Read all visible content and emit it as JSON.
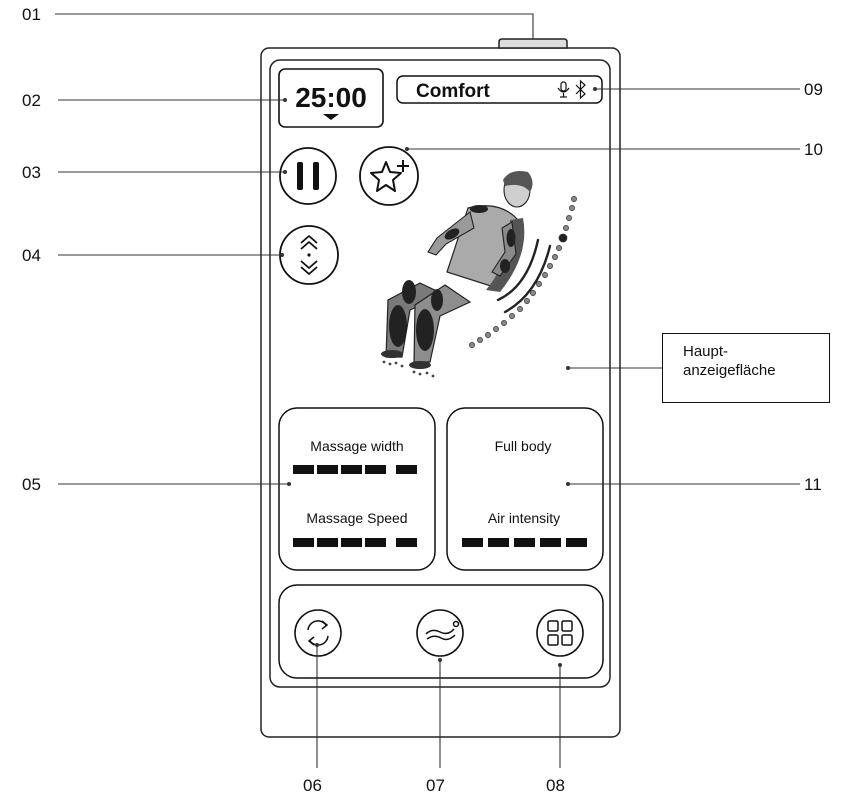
{
  "callouts": [
    {
      "id": "01"
    },
    {
      "id": "02"
    },
    {
      "id": "03"
    },
    {
      "id": "04"
    },
    {
      "id": "05"
    },
    {
      "id": "06"
    },
    {
      "id": "07"
    },
    {
      "id": "08"
    },
    {
      "id": "09"
    },
    {
      "id": "10"
    },
    {
      "id": "11"
    }
  ],
  "timer": {
    "value": "25:00"
  },
  "mode": {
    "label": "Comfort",
    "icons": [
      "microphone-icon",
      "bluetooth-icon"
    ]
  },
  "left_panel": {
    "width_label": "Massage width",
    "speed_label": "Massage Speed",
    "width_level_segments": 5,
    "speed_level_segments": 5
  },
  "right_panel": {
    "area_label": "Full body",
    "air_label": "Air intensity",
    "air_level_segments": 5
  },
  "buttons": {
    "pause": "pause-icon",
    "favorite": "star-plus-icon",
    "position": "up-down-chevrons-icon",
    "auto_programs": "rotate-arrows-icon",
    "recline_position": "reclining-body-icon",
    "menu": "grid-icon"
  },
  "annotation": {
    "line1": "Haupt-",
    "line2": "anzeigefläche"
  }
}
